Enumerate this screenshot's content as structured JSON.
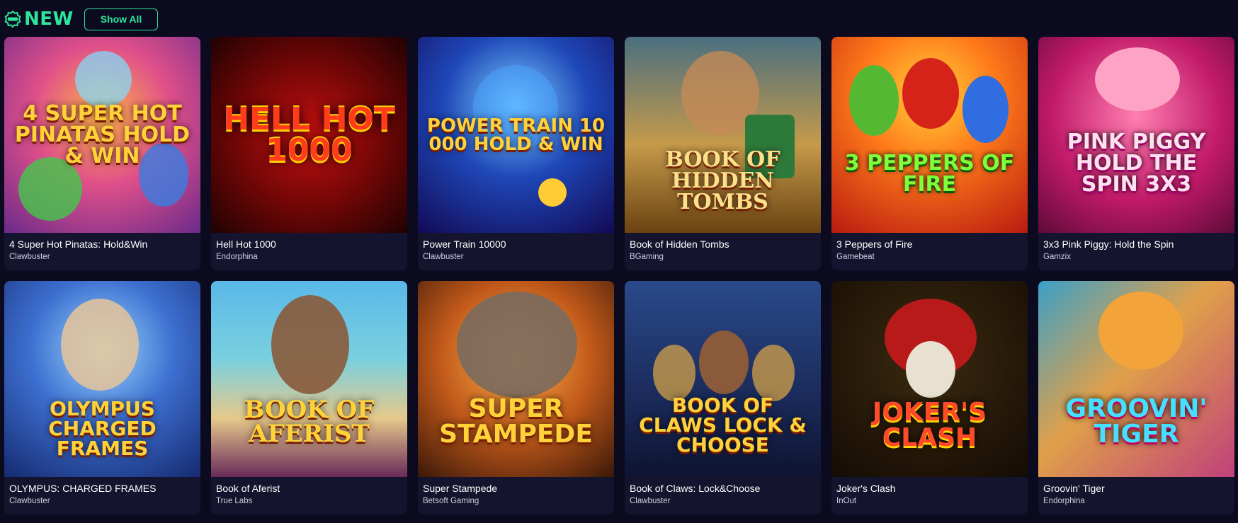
{
  "section": {
    "title": "NEW",
    "icon": "new-badge-icon",
    "show_all_label": "Show All",
    "accent_color": "#2ee59d"
  },
  "games": [
    {
      "name": "4 Super Hot Pinatas: Hold&Win",
      "provider": "Clawbuster",
      "art_text": "4 SUPER HOT PINATAS HOLD & WIN"
    },
    {
      "name": "Hell Hot 1000",
      "provider": "Endorphina",
      "art_text": "HELL HOT 1000"
    },
    {
      "name": "Power Train 10000",
      "provider": "Clawbuster",
      "art_text": "POWER TRAIN 10 000 HOLD & WIN"
    },
    {
      "name": "Book of Hidden Tombs",
      "provider": "BGaming",
      "art_text": "BOOK OF HIDDEN TOMBS"
    },
    {
      "name": "3 Peppers of Fire",
      "provider": "Gamebeat",
      "art_text": "3 PEPPERS OF FIRE"
    },
    {
      "name": "3x3 Pink Piggy: Hold the Spin",
      "provider": "Gamzix",
      "art_text": "PINK PIGGY HOLD THE SPIN 3x3"
    },
    {
      "name": "OLYMPUS: CHARGED FRAMES",
      "provider": "Clawbuster",
      "art_text": "OLYMPUS CHARGED FRAMES"
    },
    {
      "name": "Book of Aferist",
      "provider": "True Labs",
      "art_text": "BOOK OF AFERIST"
    },
    {
      "name": "Super Stampede",
      "provider": "Betsoft Gaming",
      "art_text": "SUPER STAMPEDE"
    },
    {
      "name": "Book of Claws: Lock&Choose",
      "provider": "Clawbuster",
      "art_text": "BOOK OF CLAWS LOCK & CHOOSE"
    },
    {
      "name": "Joker's Clash",
      "provider": "InOut",
      "art_text": "JOKER'S CLASH"
    },
    {
      "name": "Groovin' Tiger",
      "provider": "Endorphina",
      "art_text": "GROOVIN' TIGER"
    }
  ]
}
